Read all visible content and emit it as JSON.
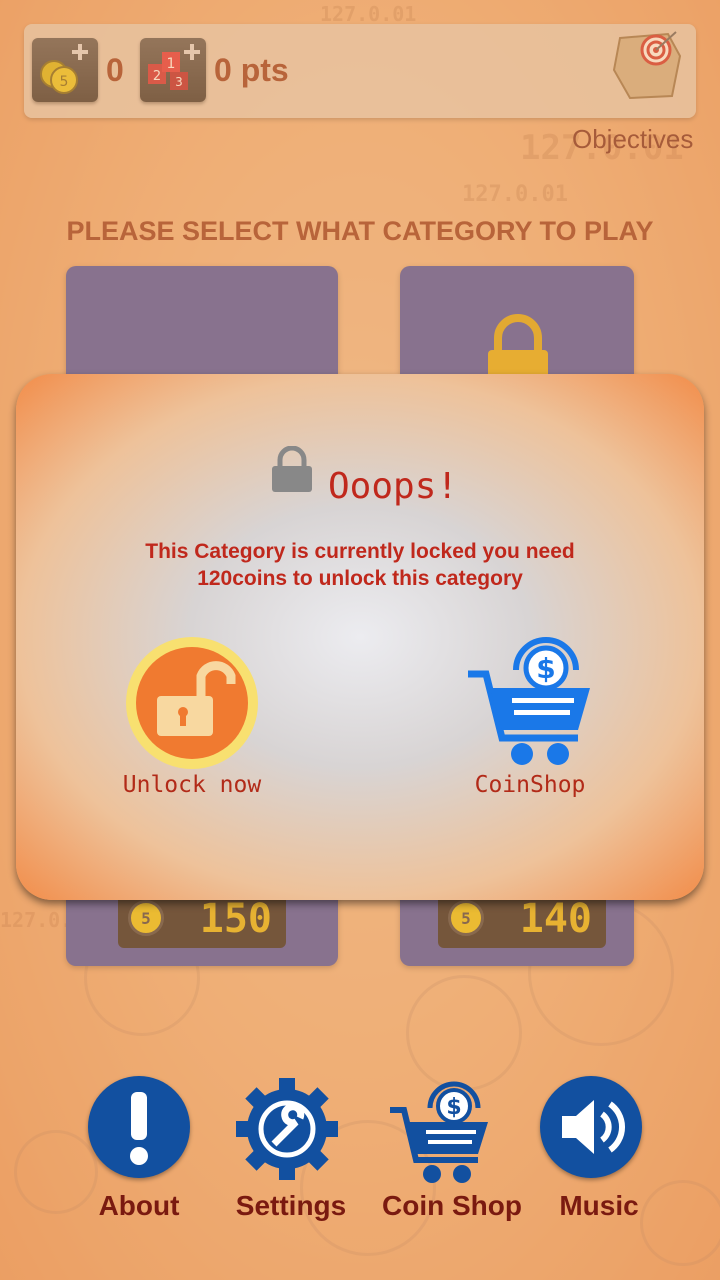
{
  "header": {
    "coins_value": "0",
    "points_value": "0 pts",
    "objectives_label": "Objectives"
  },
  "watermark_texts": [
    "127.0.01",
    "127.0.01",
    "127.0.01",
    "127.0.01"
  ],
  "page": {
    "title": "PLEASE SELECT WHAT CATEGORY TO PLAY"
  },
  "categories": [
    {
      "price": "150"
    },
    {
      "price": "140"
    }
  ],
  "dialog": {
    "title": "Ooops!",
    "message": "This Category is currently locked you need 120coins to unlock this category",
    "unlock_label": "Unlock now",
    "shop_label": "CoinShop"
  },
  "bottom_nav": {
    "about": "About",
    "settings": "Settings",
    "coin_shop": "Coin Shop",
    "music": "Music"
  },
  "colors": {
    "primary_blue": "#1250a0",
    "title_red": "#8a2a10",
    "dialog_red": "#c0281c",
    "shop_blue": "#1a78e8",
    "unlock_orange": "#f07a30"
  }
}
